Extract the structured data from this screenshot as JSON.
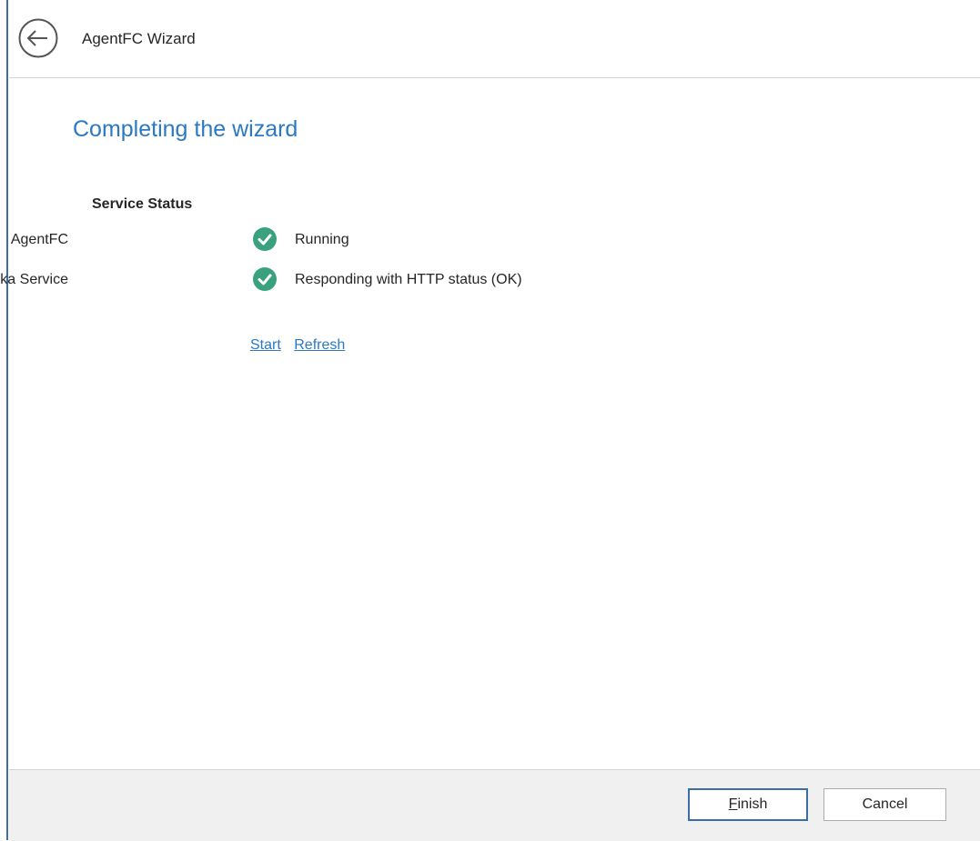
{
  "header": {
    "title": "AgentFC Wizard",
    "back_icon": "arrow-left-icon"
  },
  "page": {
    "title": "Completing the wizard"
  },
  "service_status": {
    "heading": "Service Status",
    "rows": [
      {
        "label": "AgentFC",
        "status": "Running",
        "icon": "check-circle-icon"
      },
      {
        "label": "Tika Service",
        "status": "Responding with HTTP status (OK)",
        "icon": "check-circle-icon"
      }
    ],
    "links": {
      "start": "Start",
      "refresh": "Refresh"
    }
  },
  "footer": {
    "finish_mnemonic": "F",
    "finish_rest": "inish",
    "cancel_label": "Cancel"
  },
  "colors": {
    "accent": "#2b79c2",
    "success": "#3aa17e",
    "border_blue": "#3a6ea8"
  }
}
